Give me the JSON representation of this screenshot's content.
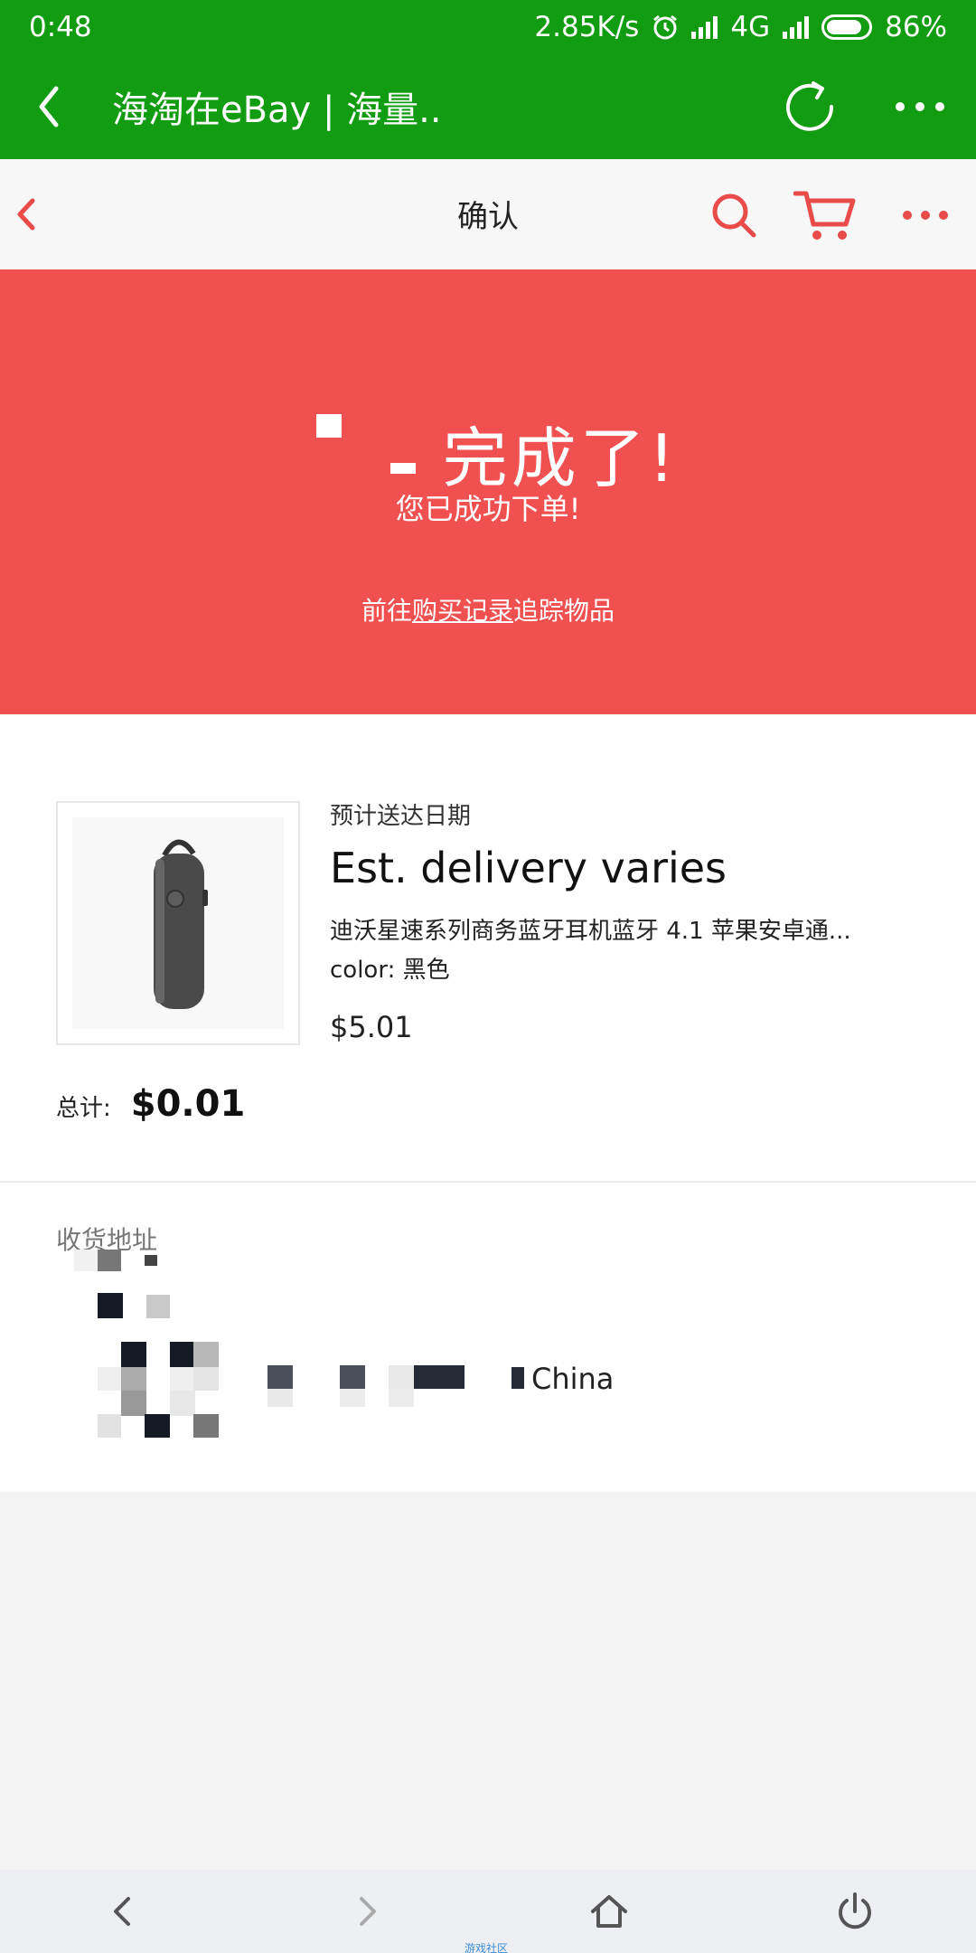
{
  "status_bar": {
    "time": "0:48",
    "net_speed": "2.85K/s",
    "network": "4G",
    "battery": "86%"
  },
  "app_bar": {
    "title": "海淘在eBay | 海量.."
  },
  "page_header": {
    "title": "确认"
  },
  "banner": {
    "title": "完成了!",
    "subtitle": "您已成功下单!",
    "link_prefix": "前往",
    "link_text": "购买记录",
    "link_suffix": "追踪物品"
  },
  "order": {
    "eta_label": "预计送达日期",
    "eta_value": "Est. delivery varies",
    "item_title": "迪沃星速系列商务蓝牙耳机蓝牙 4.1 苹果安卓通...",
    "item_color": "color: 黑色",
    "item_price": "$5.01",
    "total_label": "总计:",
    "total_value": "$0.01"
  },
  "address": {
    "label": "收货地址",
    "country": "China"
  },
  "bottom_nav": {
    "watermark": "游戏社区"
  },
  "colors": {
    "green": "#129c12",
    "banner_red": "#f05050",
    "accent_red": "#e94a4a"
  },
  "icons": {
    "status": [
      "alarm-icon",
      "signal-icon",
      "battery-icon"
    ],
    "app_bar": [
      "back-icon",
      "refresh-icon",
      "more-icon"
    ],
    "header": [
      "back-icon",
      "search-icon",
      "cart-icon",
      "more-icon"
    ],
    "bottom_nav": [
      "back-icon",
      "forward-icon",
      "home-icon",
      "power-icon"
    ]
  }
}
